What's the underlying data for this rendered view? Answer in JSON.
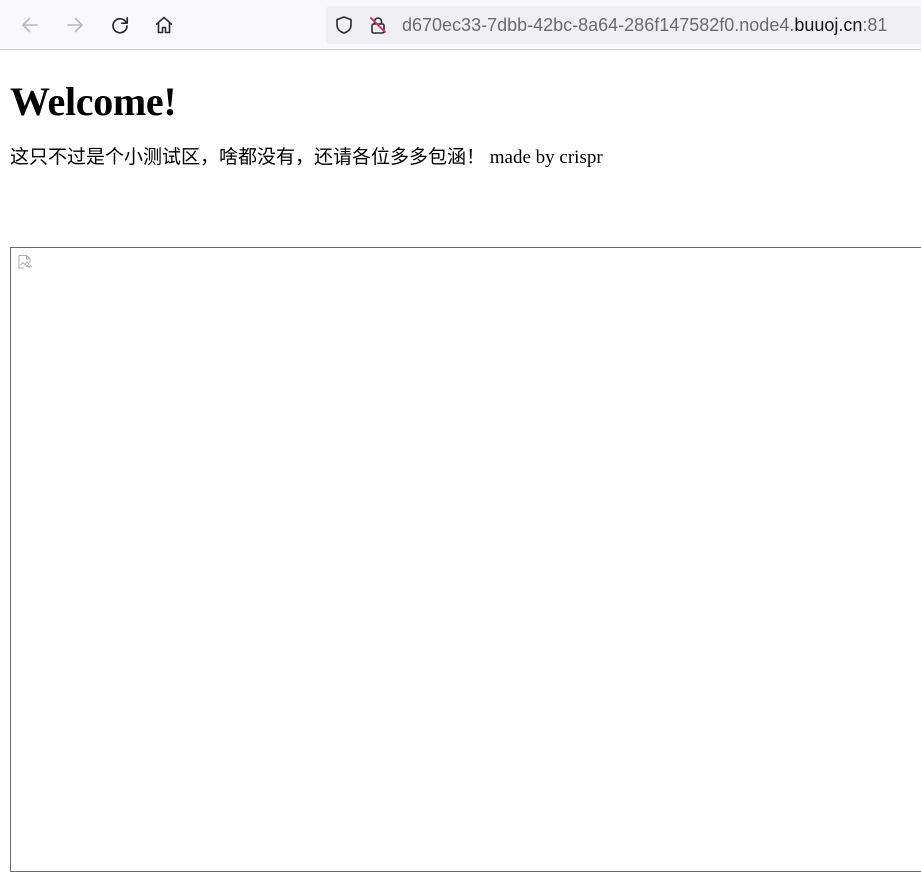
{
  "browser": {
    "url_prefix": "d670ec33-7dbb-42bc-8a64-286f147582f0.node4.",
    "url_host": "buuoj.cn",
    "url_port": ":81",
    "icons": {
      "back": "arrow-left-icon",
      "forward": "arrow-right-icon",
      "reload": "reload-icon",
      "home": "home-icon",
      "tracking": "shield-icon",
      "security": "insecure-lock-icon"
    }
  },
  "page": {
    "heading": "Welcome!",
    "intro_cn": "这只不过是个小测试区，啥都没有，还请各位多多包涵！",
    "intro_en": " made by crispr",
    "embedded": {
      "icon": "broken-image-icon"
    }
  },
  "colors": {
    "toolbar_bg": "#f9f9fb",
    "urlbar_bg": "#f0f0f4",
    "insecure_slash": "#e22850",
    "frame_border": "#6b6b6b"
  }
}
